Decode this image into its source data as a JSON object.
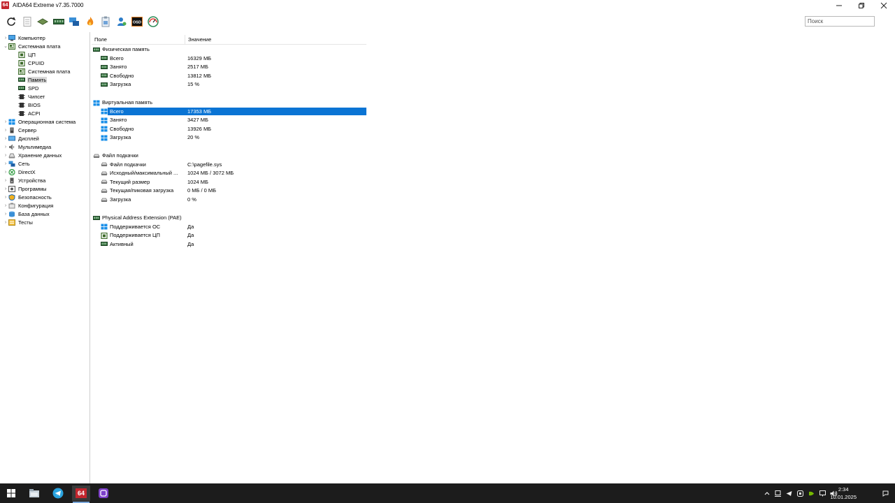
{
  "window": {
    "title": "AIDA64 Extreme v7.35.7000",
    "logo_text": "64"
  },
  "toolbar": {
    "search_placeholder": "Поиск"
  },
  "tree": {
    "items": [
      {
        "label": "Компьютер",
        "expander": "›"
      },
      {
        "label": "Системная плата",
        "expander": "⌄"
      },
      {
        "label": "ЦП"
      },
      {
        "label": "CPUID"
      },
      {
        "label": "Системная плата"
      },
      {
        "label": "Память"
      },
      {
        "label": "SPD"
      },
      {
        "label": "Чипсет"
      },
      {
        "label": "BIOS"
      },
      {
        "label": "ACPI"
      },
      {
        "label": "Операционная система",
        "expander": "›"
      },
      {
        "label": "Сервер",
        "expander": "›"
      },
      {
        "label": "Дисплей",
        "expander": "›"
      },
      {
        "label": "Мультимедиа",
        "expander": "›"
      },
      {
        "label": "Хранение данных",
        "expander": "›"
      },
      {
        "label": "Сеть",
        "expander": "›"
      },
      {
        "label": "DirectX",
        "expander": "›"
      },
      {
        "label": "Устройства",
        "expander": "›"
      },
      {
        "label": "Программы",
        "expander": "›"
      },
      {
        "label": "Безопасность",
        "expander": "›"
      },
      {
        "label": "Конфигурация",
        "expander": "›"
      },
      {
        "label": "База данных",
        "expander": "›"
      },
      {
        "label": "Тесты",
        "expander": "›"
      }
    ]
  },
  "list": {
    "header": {
      "field": "Поле",
      "value": "Значение"
    },
    "groups": [
      {
        "title": "Физическая память",
        "rows": [
          {
            "field": "Всего",
            "value": "16329 МБ"
          },
          {
            "field": "Занято",
            "value": "2517 МБ"
          },
          {
            "field": "Свободно",
            "value": "13812 МБ"
          },
          {
            "field": "Загрузка",
            "value": "15 %"
          }
        ]
      },
      {
        "title": "Виртуальная память",
        "rows": [
          {
            "field": "Всего",
            "value": "17353 МБ"
          },
          {
            "field": "Занято",
            "value": "3427 МБ"
          },
          {
            "field": "Свободно",
            "value": "13926 МБ"
          },
          {
            "field": "Загрузка",
            "value": "20 %"
          }
        ]
      },
      {
        "title": "Файл подкачки",
        "rows": [
          {
            "field": "Файл подкачки",
            "value": "C:\\pagefile.sys"
          },
          {
            "field": "Исходный/максимальный ...",
            "value": "1024 МБ / 3072 МБ"
          },
          {
            "field": "Текущий размер",
            "value": "1024 МБ"
          },
          {
            "field": "Текущая/пиковая загрузка",
            "value": "0 МБ / 0 МБ"
          },
          {
            "field": "Загрузка",
            "value": "0 %"
          }
        ]
      },
      {
        "title": "Physical Address Extension (PAE)",
        "rows": [
          {
            "field": "Поддерживается ОС",
            "value": "Да"
          },
          {
            "field": "Поддерживается ЦП",
            "value": "Да"
          },
          {
            "field": "Активный",
            "value": "Да"
          }
        ]
      }
    ]
  },
  "taskbar": {
    "time": "2:34",
    "date": "10.01.2025",
    "aida_text": "64"
  },
  "colors": {
    "selection": "#0a74d4",
    "taskbar": "#1c1c1c",
    "logo": "#c4262e",
    "memory_green": "#2f6b3a",
    "windows_blue": "#1a8fe8"
  }
}
